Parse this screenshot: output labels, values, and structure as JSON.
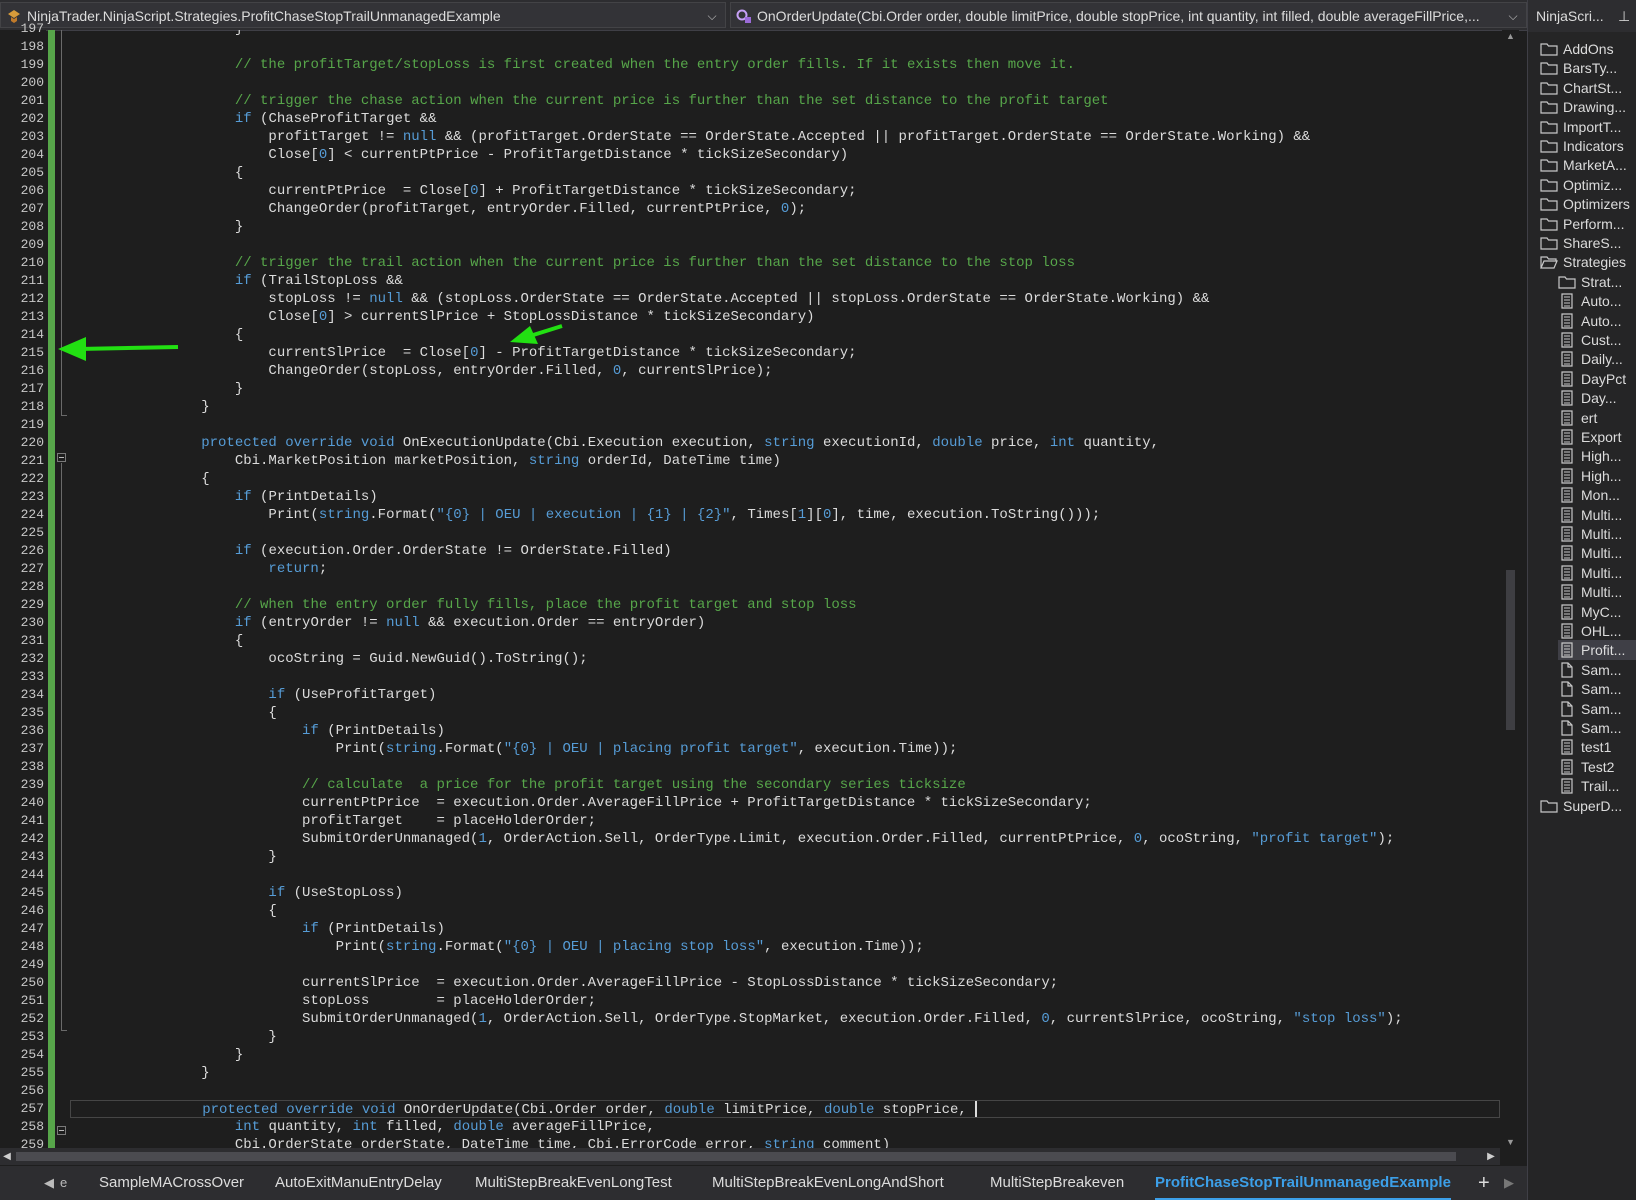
{
  "header": {
    "class_selector": "NinjaTrader.NinjaScript.Strategies.ProfitChaseStopTrailUnmanagedExample",
    "member_selector": "OnOrderUpdate(Cbi.Order order, double limitPrice, double stopPrice, int quantity, int filled, double averageFillPrice,..."
  },
  "editor": {
    "line_numbers": [
      "197",
      "198",
      "199",
      "200",
      "201",
      "202",
      "203",
      "204",
      "205",
      "206",
      "207",
      "208",
      "209",
      "210",
      "211",
      "212",
      "213",
      "214",
      "215",
      "216",
      "217",
      "218",
      "219",
      "220",
      "221",
      "222",
      "223",
      "224",
      "225",
      "226",
      "227",
      "228",
      "229",
      "230",
      "231",
      "232",
      "233",
      "234",
      "235",
      "236",
      "237",
      "238",
      "239",
      "240",
      "241",
      "242",
      "243",
      "244",
      "245",
      "246",
      "247",
      "248",
      "249",
      "250",
      "251",
      "252",
      "253",
      "254",
      "255",
      "256",
      "257",
      "258",
      "259"
    ],
    "code_lines": [
      "            }",
      "",
      "            // the profitTarget/stopLoss is first created when the entry order fills. If it exists then move it.",
      "",
      "            // trigger the chase action when the current price is further than the set distance to the profit target",
      "            if (ChaseProfitTarget &&",
      "                profitTarget != null && (profitTarget.OrderState == OrderState.Accepted || profitTarget.OrderState == OrderState.Working) &&",
      "                Close[0] < currentPtPrice - ProfitTargetDistance * tickSizeSecondary)",
      "            {",
      "                currentPtPrice  = Close[0] + ProfitTargetDistance * tickSizeSecondary;",
      "                ChangeOrder(profitTarget, entryOrder.Filled, currentPtPrice, 0);",
      "            }",
      "",
      "            // trigger the trail action when the current price is further than the set distance to the stop loss",
      "            if (TrailStopLoss &&",
      "                stopLoss != null && (stopLoss.OrderState == OrderState.Accepted || stopLoss.OrderState == OrderState.Working) &&",
      "                Close[0] > currentSlPrice + StopLossDistance * tickSizeSecondary)",
      "            {",
      "                currentSlPrice  = Close[0] - ProfitTargetDistance * tickSizeSecondary;",
      "                ChangeOrder(stopLoss, entryOrder.Filled, 0, currentSlPrice);",
      "            }",
      "        }",
      "",
      "        protected override void OnExecutionUpdate(Cbi.Execution execution, string executionId, double price, int quantity,",
      "            Cbi.MarketPosition marketPosition, string orderId, DateTime time)",
      "        {",
      "            if (PrintDetails)",
      "                Print(string.Format(\"{0} | OEU | execution | {1} | {2}\", Times[1][0], time, execution.ToString()));",
      "",
      "            if (execution.Order.OrderState != OrderState.Filled)",
      "                return;",
      "",
      "            // when the entry order fully fills, place the profit target and stop loss",
      "            if (entryOrder != null && execution.Order == entryOrder)",
      "            {",
      "                ocoString = Guid.NewGuid().ToString();",
      "",
      "                if (UseProfitTarget)",
      "                {",
      "                    if (PrintDetails)",
      "                        Print(string.Format(\"{0} | OEU | placing profit target\", execution.Time));",
      "",
      "                    // calculate  a price for the profit target using the secondary series ticksize",
      "                    currentPtPrice  = execution.Order.AverageFillPrice + ProfitTargetDistance * tickSizeSecondary;",
      "                    profitTarget    = placeHolderOrder;",
      "                    SubmitOrderUnmanaged(1, OrderAction.Sell, OrderType.Limit, execution.Order.Filled, currentPtPrice, 0, ocoString, \"profit target\");",
      "                }",
      "",
      "                if (UseStopLoss)",
      "                {",
      "                    if (PrintDetails)",
      "                        Print(string.Format(\"{0} | OEU | placing stop loss\", execution.Time));",
      "",
      "                    currentSlPrice  = execution.Order.AverageFillPrice - StopLossDistance * tickSizeSecondary;",
      "                    stopLoss        = placeHolderOrder;",
      "                    SubmitOrderUnmanaged(1, OrderAction.Sell, OrderType.StopMarket, execution.Order.Filled, 0, currentSlPrice, ocoString, \"stop loss\");",
      "                }",
      "            }",
      "        }",
      "",
      "        protected override void OnOrderUpdate(Cbi.Order order, double limitPrice, double stopPrice, ",
      "            int quantity, int filled, double averageFillPrice,",
      "            Cbi.OrderState orderState, DateTime time, Cbi.ErrorCode error, string comment)"
    ],
    "current_line": "257"
  },
  "tabs": {
    "overflow_label": "e",
    "items": [
      {
        "label": "SampleMACrossOver",
        "active": false
      },
      {
        "label": "AutoExitManuEntryDelay",
        "active": false
      },
      {
        "label": "MultiStepBreakEvenLongTest",
        "active": false
      },
      {
        "label": "MultiStepBreakEvenLongAndShort",
        "active": false
      },
      {
        "label": "MultiStepBreakeven",
        "active": false
      },
      {
        "label": "ProfitChaseStopTrailUnmanagedExample",
        "active": true
      }
    ],
    "add_label": "+"
  },
  "explorer": {
    "title": "NinjaScri...",
    "pin_icon": "pin-icon",
    "items": [
      {
        "label": "AddOns",
        "icon": "folder-icon",
        "level": 0
      },
      {
        "label": "BarsTy...",
        "icon": "folder-icon",
        "level": 0
      },
      {
        "label": "ChartSt...",
        "icon": "folder-icon",
        "level": 0
      },
      {
        "label": "Drawing...",
        "icon": "folder-icon",
        "level": 0
      },
      {
        "label": "ImportT...",
        "icon": "folder-icon",
        "level": 0
      },
      {
        "label": "Indicators",
        "icon": "folder-icon",
        "level": 0
      },
      {
        "label": "MarketA...",
        "icon": "folder-icon",
        "level": 0
      },
      {
        "label": "Optimiz...",
        "icon": "folder-icon",
        "level": 0
      },
      {
        "label": "Optimizers",
        "icon": "folder-icon",
        "level": 0
      },
      {
        "label": "Perform...",
        "icon": "folder-icon",
        "level": 0
      },
      {
        "label": "ShareS...",
        "icon": "folder-icon",
        "level": 0
      },
      {
        "label": "Strategies",
        "icon": "folder-open-icon",
        "level": 0
      },
      {
        "label": "Strat...",
        "icon": "folder-icon",
        "level": 1
      },
      {
        "label": "Auto...",
        "icon": "file-icon",
        "level": 1
      },
      {
        "label": "Auto...",
        "icon": "file-icon",
        "level": 1
      },
      {
        "label": "Cust...",
        "icon": "file-icon",
        "level": 1
      },
      {
        "label": "Daily...",
        "icon": "file-icon",
        "level": 1
      },
      {
        "label": "DayPct",
        "icon": "file-icon",
        "level": 1
      },
      {
        "label": "Day...",
        "icon": "file-icon",
        "level": 1
      },
      {
        "label": "ert",
        "icon": "file-icon",
        "level": 1
      },
      {
        "label": "Export",
        "icon": "file-icon",
        "level": 1
      },
      {
        "label": "High...",
        "icon": "file-icon",
        "level": 1
      },
      {
        "label": "High...",
        "icon": "file-icon",
        "level": 1
      },
      {
        "label": "Mon...",
        "icon": "file-icon",
        "level": 1
      },
      {
        "label": "Multi...",
        "icon": "file-icon",
        "level": 1
      },
      {
        "label": "Multi...",
        "icon": "file-icon",
        "level": 1
      },
      {
        "label": "Multi...",
        "icon": "file-icon",
        "level": 1
      },
      {
        "label": "Multi...",
        "icon": "file-icon",
        "level": 1
      },
      {
        "label": "Multi...",
        "icon": "file-icon",
        "level": 1
      },
      {
        "label": "MyC...",
        "icon": "file-icon",
        "level": 1
      },
      {
        "label": "OHL...",
        "icon": "file-icon",
        "level": 1
      },
      {
        "label": "Profit...",
        "icon": "file-icon",
        "level": 1,
        "selected": true
      },
      {
        "label": "Sam...",
        "icon": "file-blank-icon",
        "level": 1
      },
      {
        "label": "Sam...",
        "icon": "file-blank-icon",
        "level": 1
      },
      {
        "label": "Sam...",
        "icon": "file-blank-icon",
        "level": 1
      },
      {
        "label": "Sam...",
        "icon": "file-blank-icon",
        "level": 1
      },
      {
        "label": "test1",
        "icon": "file-icon",
        "level": 1
      },
      {
        "label": "Test2",
        "icon": "file-icon",
        "level": 1
      },
      {
        "label": "Trail...",
        "icon": "file-icon",
        "level": 1
      },
      {
        "label": "SuperD...",
        "icon": "folder-icon",
        "level": 0
      }
    ]
  },
  "colors": {
    "editor_bg": "#1e1e1e",
    "keyword": "#569cd6",
    "comment": "#57a64a",
    "text": "#dcdcdc",
    "change_bar": "#57a64a",
    "annotation_arrow": "#22e012",
    "active_tab": "#3c9fe8"
  }
}
